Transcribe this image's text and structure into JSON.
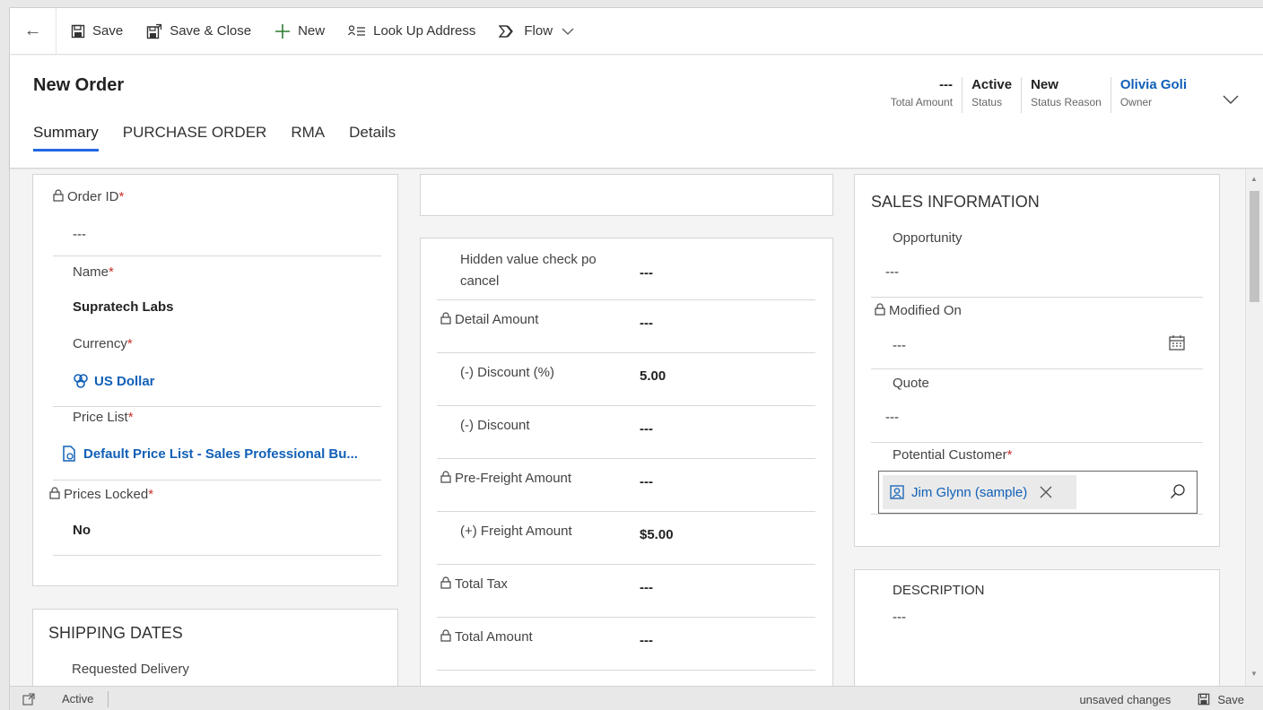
{
  "toolbar": {
    "save": "Save",
    "save_close": "Save & Close",
    "new": "New",
    "lookup_address": "Look Up Address",
    "flow": "Flow"
  },
  "header": {
    "title": "New Order",
    "fields": [
      {
        "value": "---",
        "label": "Total Amount"
      },
      {
        "value": "Active",
        "label": "Status"
      },
      {
        "value": "New",
        "label": "Status Reason"
      },
      {
        "value": "Olivia Goli",
        "label": "Owner"
      }
    ],
    "tabs": [
      "Summary",
      "PURCHASE ORDER",
      "RMA",
      "Details"
    ]
  },
  "left": {
    "order_id": {
      "label": "Order ID",
      "value": "---"
    },
    "name": {
      "label": "Name",
      "value": "Supratech Labs"
    },
    "currency": {
      "label": "Currency",
      "value": "US Dollar"
    },
    "price_list": {
      "label": "Price List",
      "value": "Default Price List - Sales Professional Bu..."
    },
    "prices_locked": {
      "label": "Prices Locked",
      "value": "No"
    },
    "shipping": {
      "title": "SHIPPING DATES",
      "requested_delivery": "Requested Delivery"
    }
  },
  "middle": {
    "rows": [
      {
        "label": "Hidden value check po cancel",
        "value": "---",
        "locked": false
      },
      {
        "label": "Detail Amount",
        "value": "---",
        "locked": true
      },
      {
        "label": "(-) Discount (%)",
        "value": "5.00",
        "locked": false
      },
      {
        "label": "(-) Discount",
        "value": "---",
        "locked": false
      },
      {
        "label": "Pre-Freight Amount",
        "value": "---",
        "locked": true
      },
      {
        "label": "(+) Freight Amount",
        "value": "$5.00",
        "locked": false
      },
      {
        "label": "Total Tax",
        "value": "---",
        "locked": true
      },
      {
        "label": "Total Amount",
        "value": "---",
        "locked": true
      }
    ]
  },
  "right": {
    "sales_title": "SALES INFORMATION",
    "opportunity": {
      "label": "Opportunity",
      "value": "---"
    },
    "modified_on": {
      "label": "Modified On",
      "value": "---"
    },
    "quote": {
      "label": "Quote",
      "value": "---"
    },
    "potential_customer": {
      "label": "Potential Customer",
      "value": "Jim Glynn (sample)"
    },
    "description": {
      "title": "DESCRIPTION",
      "value": "---"
    }
  },
  "statusbar": {
    "status": "Active",
    "unsaved": "unsaved changes",
    "save": "Save"
  },
  "colors": {
    "accent": "#2266e3",
    "link": "#1160b7",
    "required": "#c8312a"
  }
}
